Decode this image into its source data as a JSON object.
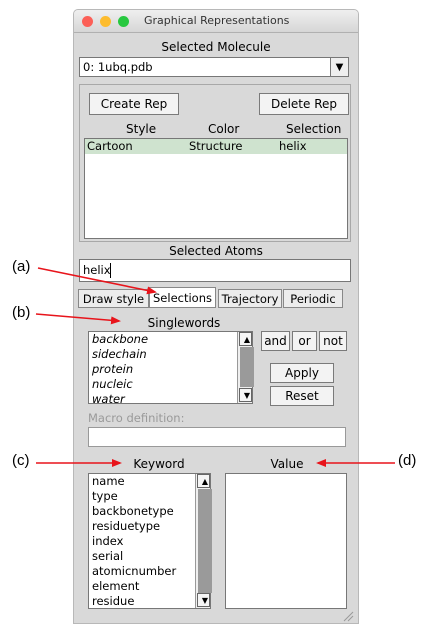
{
  "window": {
    "title": "Graphical Representations"
  },
  "molecule": {
    "label": "Selected Molecule",
    "value": "0: 1ubq.pdb"
  },
  "reps": {
    "create_label": "Create Rep",
    "delete_label": "Delete Rep",
    "columns": [
      "Style",
      "Color",
      "Selection"
    ],
    "rows": [
      {
        "style": "Cartoon",
        "color": "Structure",
        "selection": "helix"
      }
    ]
  },
  "atoms": {
    "label": "Selected Atoms",
    "value": "helix"
  },
  "tabs": [
    "Draw style",
    "Selections",
    "Trajectory",
    "Periodic"
  ],
  "singlewords": {
    "label": "Singlewords",
    "items": [
      "backbone",
      "sidechain",
      "protein",
      "nucleic",
      "water"
    ]
  },
  "logic": {
    "and_label": "and",
    "or_label": "or",
    "not_label": "not"
  },
  "actions": {
    "apply_label": "Apply",
    "reset_label": "Reset"
  },
  "macro": {
    "label": "Macro definition:",
    "value": ""
  },
  "keyword": {
    "label": "Keyword",
    "items": [
      "name",
      "type",
      "backbonetype",
      "residuetype",
      "index",
      "serial",
      "atomicnumber",
      "element",
      "residue"
    ]
  },
  "value": {
    "label": "Value",
    "items": []
  },
  "annotations": {
    "a": "(a)",
    "b": "(b)",
    "c": "(c)",
    "d": "(d)"
  },
  "colors": {
    "close": "#fc5f57",
    "minimize": "#fdbc2e",
    "zoom": "#28c840",
    "arrow": "#e8141b",
    "selected_row": "#cfe3cf"
  }
}
